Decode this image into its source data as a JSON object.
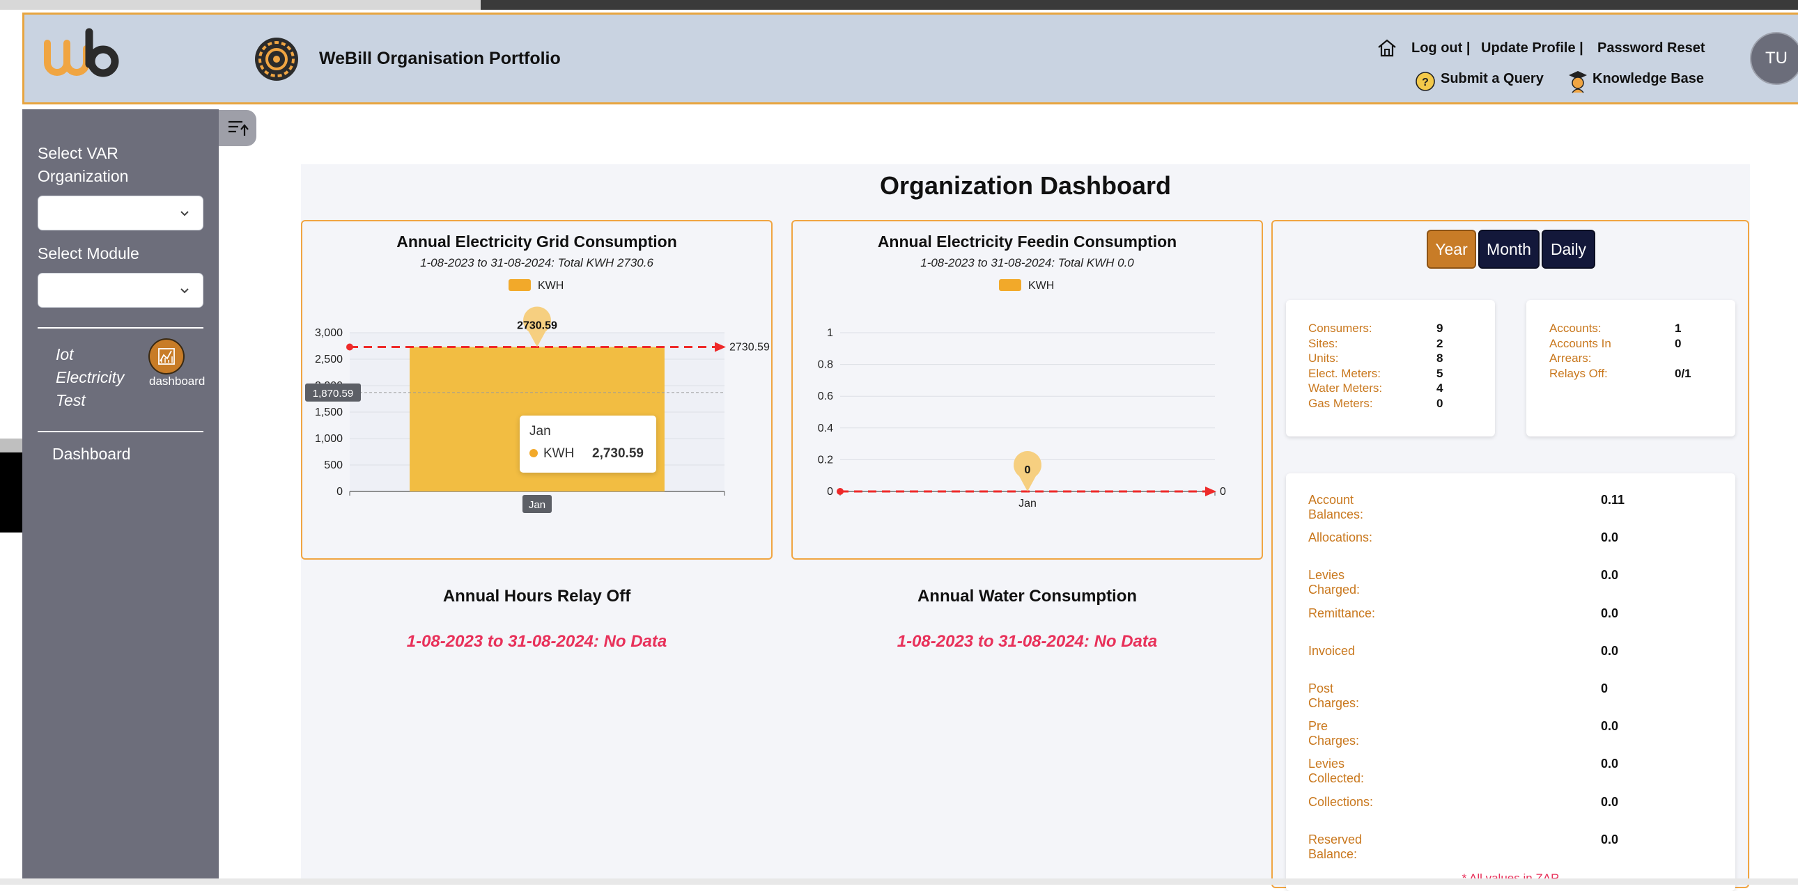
{
  "header": {
    "app_title": "WeBill Organisation Portfolio",
    "links_top": [
      "Log out",
      "Update Profile",
      "Password Reset"
    ],
    "links_bottom": [
      "Submit a Query",
      "Knowledge Base"
    ],
    "avatar_initials": "TU",
    "separator": "|"
  },
  "sidebar": {
    "select_org_label": "Select VAR Organization",
    "select_org_value": "",
    "select_module_label": "Select Module",
    "select_module_value": "",
    "module_name": "Iot Electricity Test",
    "module_link_label": "dashboard",
    "dashboard_label": "Dashboard"
  },
  "main": {
    "title": "Organization Dashboard",
    "grid_chart": {
      "title": "Annual Electricity Grid Consumption",
      "subtitle": "1-08-2023 to 31-08-2024: Total KWH 2730.6",
      "legend": "KWH",
      "peak_label": "2730.59",
      "line_label": "2730.59",
      "crosshair_label": "1,870.59",
      "x_hover_label": "Jan",
      "tooltip": {
        "title": "Jan",
        "series": "KWH",
        "value": "2,730.59"
      }
    },
    "feedin_chart": {
      "title": "Annual Electricity Feedin Consumption",
      "subtitle": "1-08-2023 to 31-08-2024: Total KWH 0.0",
      "legend": "KWH",
      "peak_label": "0",
      "line_label": "0"
    },
    "relay_section": {
      "title": "Annual Hours Relay Off",
      "message": "1-08-2023 to 31-08-2024: No Data"
    },
    "water_section": {
      "title": "Annual Water Consumption",
      "message": "1-08-2023 to 31-08-2024: No Data"
    },
    "period_buttons": [
      "Year",
      "Month",
      "Daily"
    ],
    "active_period": "Year",
    "stats_left": [
      {
        "label": "Consumers:",
        "value": "9"
      },
      {
        "label": "Sites:",
        "value": "2"
      },
      {
        "label": "Units:",
        "value": "8"
      },
      {
        "label": "Elect. Meters:",
        "value": "5"
      },
      {
        "label": "Water Meters:",
        "value": "4"
      },
      {
        "label": "Gas Meters:",
        "value": "0"
      }
    ],
    "stats_right": [
      {
        "label": "Accounts:",
        "value": "1"
      },
      {
        "label": "Accounts In",
        "value": "0"
      },
      {
        "label": "Arrears:",
        "value": ""
      },
      {
        "label": "Relays Off:",
        "value": "0/1"
      }
    ],
    "balances": [
      {
        "label": "Account Balances:",
        "value": "0.11"
      },
      {
        "label": "Allocations:",
        "value": "0.0"
      },
      {
        "label": "Levies Charged:",
        "value": "0.0"
      },
      {
        "label": "Remittance:",
        "value": "0.0"
      },
      {
        "label": "Invoiced",
        "value": "0.0"
      },
      {
        "label": "Post Charges:",
        "value": "0"
      },
      {
        "label": "Pre Charges:",
        "value": "0.0"
      },
      {
        "label": "Levies Collected:",
        "value": "0.0"
      },
      {
        "label": "Collections:",
        "value": "0.0"
      },
      {
        "label": "Reserved Balance:",
        "value": "0.0"
      }
    ],
    "footnote": "* All values in ZAR"
  },
  "colors": {
    "accent": "#f0a542",
    "bar": "#f2bd42",
    "threshold_line": "#ee2a2a",
    "no_data": "#e8315a",
    "sidebar": "#6d6e7b",
    "header": "#c9d3e1"
  },
  "chart_data": [
    {
      "type": "bar",
      "title": "Annual Electricity Grid Consumption",
      "subtitle": "1-08-2023 to 31-08-2024: Total KWH 2730.6",
      "categories": [
        "Jan"
      ],
      "series": [
        {
          "name": "KWH",
          "values": [
            2730.59
          ]
        }
      ],
      "ylim": [
        0,
        3000
      ],
      "yticks": [
        "0",
        "500",
        "1,000",
        "1,500",
        "2,000",
        "2,500",
        "3,000"
      ],
      "reference_line": 2730.59,
      "grid": true,
      "legend": "top"
    },
    {
      "type": "line",
      "title": "Annual Electricity Feedin Consumption",
      "subtitle": "1-08-2023 to 31-08-2024: Total KWH 0.0",
      "categories": [
        "Jan"
      ],
      "series": [
        {
          "name": "KWH",
          "values": [
            0
          ]
        }
      ],
      "ylim": [
        0,
        1
      ],
      "yticks": [
        "0",
        "0.2",
        "0.4",
        "0.6",
        "0.8",
        "1"
      ],
      "reference_line": 0,
      "grid": true,
      "legend": "top"
    }
  ]
}
